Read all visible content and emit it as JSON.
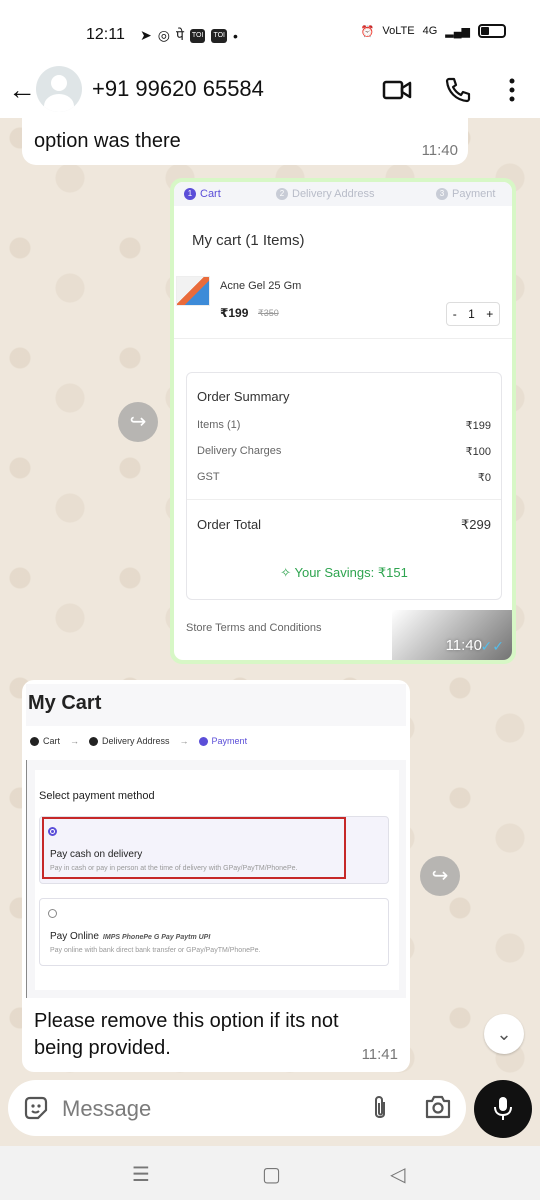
{
  "status": {
    "time": "12:11",
    "network": "4G",
    "volte": "VoLTE"
  },
  "header": {
    "contact": "+91 99620 65584"
  },
  "messages": {
    "top": {
      "text": "option was there",
      "time": "11:40"
    },
    "sent": {
      "time": "11:40",
      "steps": [
        "Cart",
        "Delivery Address",
        "Payment"
      ],
      "step_numbers": [
        "1",
        "2",
        "3"
      ],
      "cart_title": "My cart (1 Items)",
      "product": {
        "name": "Acne Gel 25 Gm",
        "price": "₹199",
        "old_price": "₹350",
        "qty": "1",
        "minus": "-",
        "plus": "+"
      },
      "summary": {
        "title": "Order Summary",
        "rows": [
          {
            "label": "Items (1)",
            "value": "₹199"
          },
          {
            "label": "Delivery Charges",
            "value": "₹100"
          },
          {
            "label": "GST",
            "value": "₹0"
          }
        ],
        "total_label": "Order Total",
        "total_value": "₹299",
        "savings": "Your Savings: ₹151"
      },
      "terms": "Store Terms and Conditions"
    },
    "received": {
      "title": "My Cart",
      "steps": [
        "Cart",
        "Delivery Address",
        "Payment"
      ],
      "step_number": "3",
      "section_label": "Select payment method",
      "options": [
        {
          "title": "Pay cash on delivery",
          "subtitle": "Pay in cash or pay in person at the time of delivery with GPay/PayTM/PhonePe.",
          "selected": true
        },
        {
          "title": "Pay Online",
          "subtitle": "Pay online with bank direct bank transfer or GPay/PayTM/PhonePe.",
          "selected": false,
          "logos": "IMPS PhonePe G Pay Paytm UPI"
        }
      ],
      "caption": "Please remove this option if its not being provided.",
      "time": "11:41"
    }
  },
  "input": {
    "placeholder": "Message"
  },
  "colors": {
    "accent": "#5b4ed8",
    "sent_bubble": "#d7f7c6",
    "savings": "#2ea44f",
    "highlight": "#c62828",
    "ticks": "#53bdeb"
  }
}
